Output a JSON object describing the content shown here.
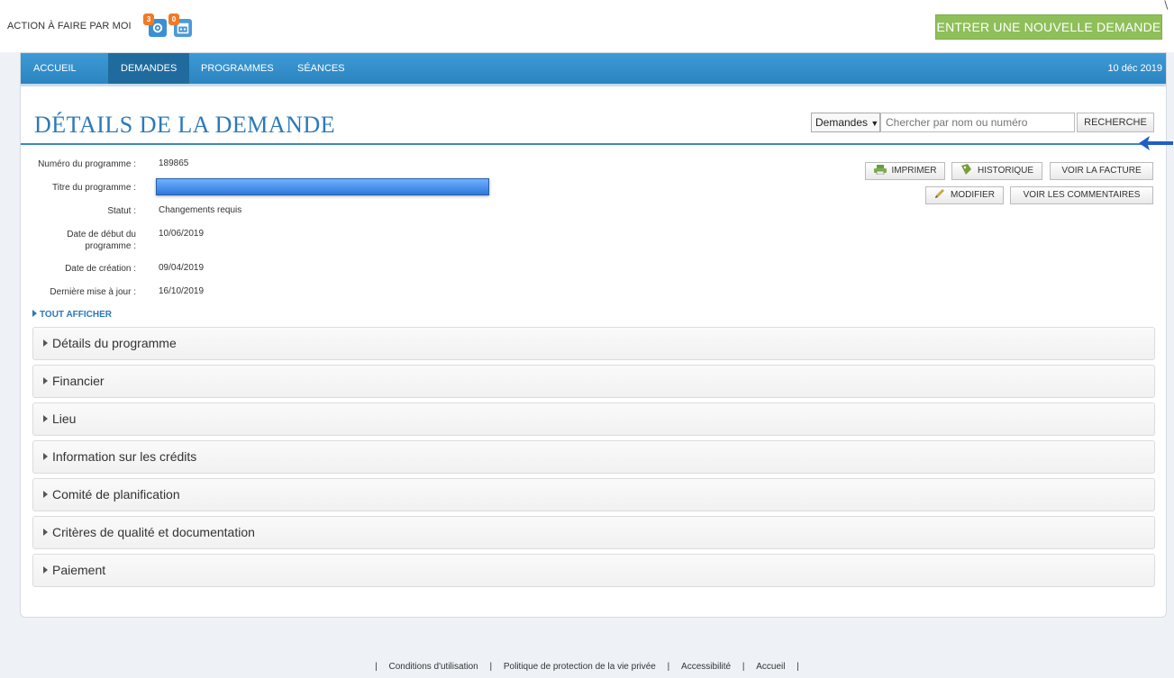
{
  "header": {
    "action_label": "ACTION À FAIRE PAR MOI",
    "badge_gear": "3",
    "badge_calendar": "0",
    "new_request_label": "ENTRER UNE NOUVELLE DEMANDE"
  },
  "nav": {
    "items": [
      {
        "label": "ACCUEIL",
        "active": false
      },
      {
        "label": "DEMANDES",
        "active": true
      },
      {
        "label": "PROGRAMMES",
        "active": false
      },
      {
        "label": "SÉANCES",
        "active": false
      }
    ],
    "date": "10 déc 2019"
  },
  "page": {
    "title": "DÉTAILS DE LA DEMANDE"
  },
  "search": {
    "scope": "Demandes",
    "placeholder": "Chercher par nom ou numéro",
    "button_label": "RECHERCHE"
  },
  "details": {
    "program_number_label": "Numéro du programme :",
    "program_number": "189865",
    "program_title_label": "Titre du programme :",
    "status_label": "Statut :",
    "status": "Changements requis",
    "start_date_label_1": "Date de début du",
    "start_date_label_2": "programme :",
    "start_date": "10/06/2019",
    "created_label": "Date de création :",
    "created": "09/04/2019",
    "updated_label": "Dernière mise à jour :",
    "updated": "16/10/2019"
  },
  "actions": {
    "print": "IMPRIMER",
    "history": "HISTORIQUE",
    "invoice": "VOIR LA FACTURE",
    "edit": "MODIFIER",
    "comments": "VOIR LES COMMENTAIRES"
  },
  "show_all_label": "TOUT AFFICHER",
  "sections": [
    "Détails du programme",
    "Financier",
    "Lieu",
    "Information sur les crédits",
    "Comité de planification",
    "Critères de qualité et documentation",
    "Paiement"
  ],
  "footer": {
    "links": [
      "Conditions d'utilisation",
      "Politique de protection de la vie privée",
      "Accessibilité",
      "Accueil"
    ],
    "separator": "|"
  },
  "colors": {
    "nav_blue": "#2b84c0",
    "title_blue": "#2c79b8",
    "new_request_green": "#8fbf59",
    "badge_orange": "#f07a25"
  }
}
